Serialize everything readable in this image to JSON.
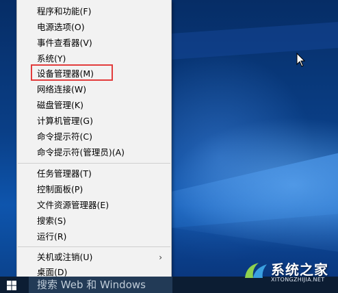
{
  "menu": {
    "items": [
      {
        "label": "程序和功能(F)"
      },
      {
        "label": "电源选项(O)"
      },
      {
        "label": "事件查看器(V)"
      },
      {
        "label": "系统(Y)"
      },
      {
        "label": "设备管理器(M)"
      },
      {
        "label": "网络连接(W)"
      },
      {
        "label": "磁盘管理(K)"
      },
      {
        "label": "计算机管理(G)"
      },
      {
        "label": "命令提示符(C)"
      },
      {
        "label": "命令提示符(管理员)(A)"
      },
      {
        "label": "任务管理器(T)"
      },
      {
        "label": "控制面板(P)"
      },
      {
        "label": "文件资源管理器(E)"
      },
      {
        "label": "搜索(S)"
      },
      {
        "label": "运行(R)"
      },
      {
        "label": "关机或注销(U)"
      },
      {
        "label": "桌面(D)"
      }
    ],
    "highlighted": "设备管理器(M)",
    "highlight_color": "#e23b3b"
  },
  "taskbar": {
    "search_text": "搜索 Web 和 Windows",
    "start_icon": "windows-logo-icon"
  },
  "watermark": {
    "title": "系统之家",
    "url": "XITONGZHIJIA.NET"
  },
  "colors": {
    "menu_bg": "#f2f2f2",
    "taskbar_bg": "#0c1d33"
  }
}
